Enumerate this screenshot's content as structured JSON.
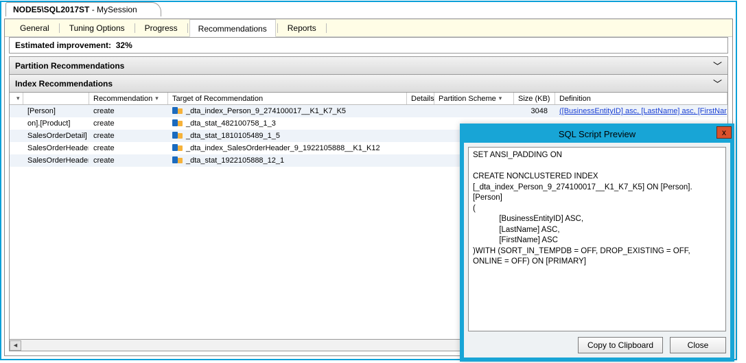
{
  "session_tab": {
    "prefix": "NODE5\\SQL2017ST",
    "suffix": " - MySession"
  },
  "tabs": {
    "general": "General",
    "tuning": "Tuning Options",
    "progress": "Progress",
    "recommendations": "Recommendations",
    "reports": "Reports"
  },
  "improvement": {
    "label": "Estimated improvement:",
    "value": "32%"
  },
  "sections": {
    "partition": "Partition Recommendations",
    "index": "Index Recommendations"
  },
  "columns": {
    "recommendation": "Recommendation",
    "target": "Target of Recommendation",
    "details": "Details",
    "partition_scheme": "Partition Scheme",
    "size": "Size (KB)",
    "definition": "Definition"
  },
  "rows": [
    {
      "db": "[Person]",
      "rec": "create",
      "target": "_dta_index_Person_9_274100017__K1_K7_K5",
      "size": "3048",
      "definition": "([BusinessEntityID] asc, [LastName] asc, [FirstName] asc)"
    },
    {
      "db": "on].[Product]",
      "rec": "create",
      "target": "_dta_stat_482100758_1_3",
      "size": "",
      "definition": ""
    },
    {
      "db": "SalesOrderDetail]",
      "rec": "create",
      "target": "_dta_stat_1810105489_1_5",
      "size": "",
      "definition": ""
    },
    {
      "db": "SalesOrderHeader]",
      "rec": "create",
      "target": "_dta_index_SalesOrderHeader_9_1922105888__K1_K12",
      "size": "",
      "definition": ""
    },
    {
      "db": "SalesOrderHeader]",
      "rec": "create",
      "target": "_dta_stat_1922105888_12_1",
      "size": "",
      "definition": ""
    }
  ],
  "dialog": {
    "title": "SQL Script Preview",
    "script": "SET ANSI_PADDING ON\n\nCREATE NONCLUSTERED INDEX\n[_dta_index_Person_9_274100017__K1_K7_K5] ON [Person].[Person]\n(\n            [BusinessEntityID] ASC,\n            [LastName] ASC,\n            [FirstName] ASC\n)WITH (SORT_IN_TEMPDB = OFF, DROP_EXISTING = OFF, ONLINE = OFF) ON [PRIMARY]",
    "copy": "Copy to Clipboard",
    "close": "Close",
    "close_x": "x"
  }
}
